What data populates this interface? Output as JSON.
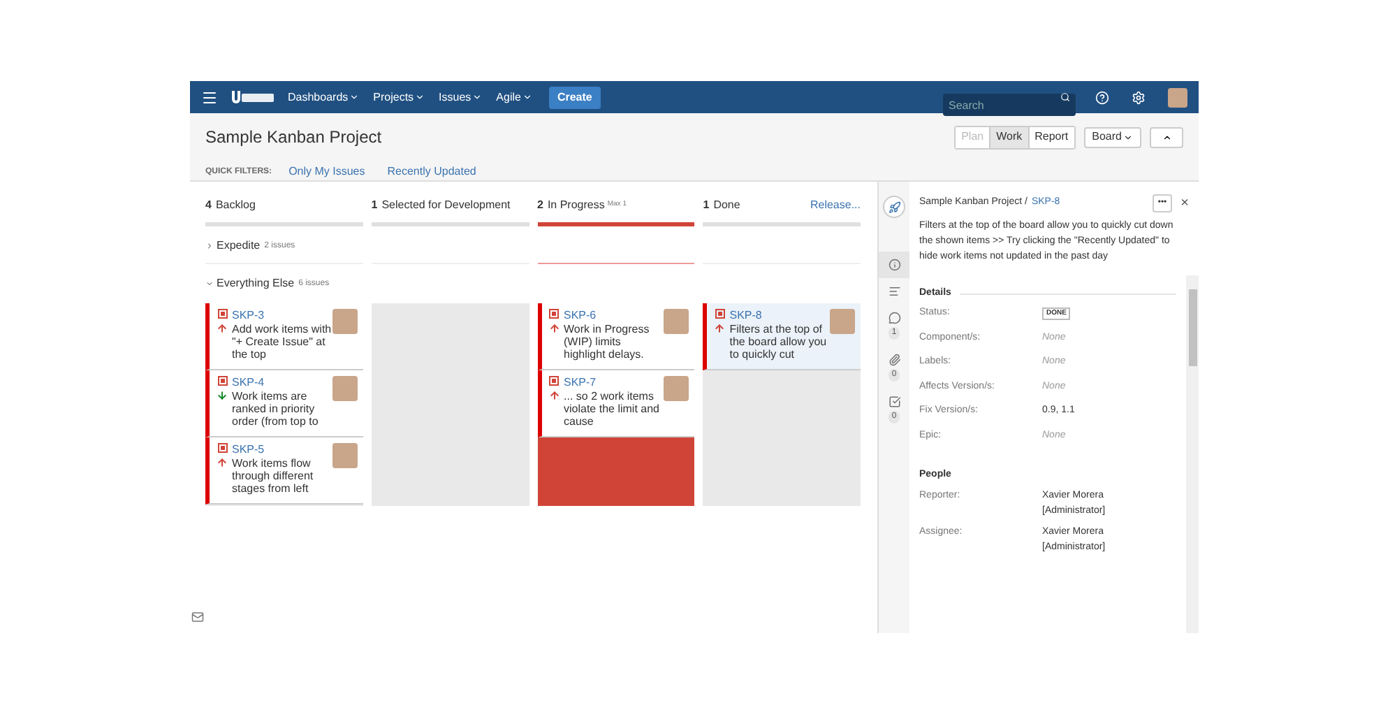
{
  "nav": {
    "menus": [
      "Dashboards",
      "Projects",
      "Issues",
      "Agile"
    ],
    "create": "Create",
    "search_placeholder": "Search"
  },
  "header": {
    "title": "Sample Kanban Project",
    "views": [
      {
        "label": "Plan",
        "selected": false,
        "disabled": true
      },
      {
        "label": "Work",
        "selected": true,
        "disabled": false
      },
      {
        "label": "Report",
        "selected": false,
        "disabled": false
      }
    ],
    "board_button": "Board"
  },
  "quick_filters": {
    "label": "QUICK FILTERS:",
    "items": [
      "Only My Issues",
      "Recently Updated"
    ]
  },
  "columns": [
    {
      "count": "4",
      "name": "Backlog",
      "over_limit": false
    },
    {
      "count": "1",
      "name": "Selected for Development",
      "over_limit": false
    },
    {
      "count": "2",
      "name": "In Progress",
      "limit": "Max 1",
      "over_limit": true
    },
    {
      "count": "1",
      "name": "Done",
      "action": "Release...",
      "over_limit": false
    }
  ],
  "swimlanes": [
    {
      "name": "Expedite",
      "count": "2 issues",
      "expanded": false
    },
    {
      "name": "Everything Else",
      "count": "6 issues",
      "expanded": true,
      "cells": [
        [
          {
            "key": "SKP-3",
            "summary": "Add work items with \"+ Create Issue\" at the top",
            "kind": "up",
            "selected": false
          },
          {
            "key": "SKP-4",
            "summary": "Work items are ranked in priority order (from top to",
            "kind": "down",
            "selected": false
          },
          {
            "key": "SKP-5",
            "summary": "Work items flow through different stages from left",
            "kind": "up",
            "selected": false
          }
        ],
        [],
        [
          {
            "key": "SKP-6",
            "summary": "Work in Progress (WIP) limits highlight delays.",
            "kind": "up",
            "selected": false
          },
          {
            "key": "SKP-7",
            "summary": "... so 2 work items violate the limit and cause",
            "kind": "up",
            "selected": false
          }
        ],
        [
          {
            "key": "SKP-8",
            "summary": "Filters at the top of the board allow you to quickly cut",
            "kind": "up",
            "selected": true
          }
        ]
      ]
    }
  ],
  "detail": {
    "project": "Sample Kanban Project /",
    "key": "SKP-8",
    "more": "•••",
    "close": "×",
    "description": "Filters at the top of the board allow you to quickly cut down the shown items >> Try clicking the \"Recently Updated\" to hide work items not updated in the past day",
    "tabs": [
      {
        "kind": "info",
        "selected": true
      },
      {
        "kind": "description",
        "selected": false
      },
      {
        "kind": "comments",
        "count": "1",
        "selected": false
      },
      {
        "kind": "attachments",
        "count": "0",
        "selected": false
      },
      {
        "kind": "subtasks",
        "count": "0",
        "selected": false
      }
    ],
    "details_heading": "Details",
    "fields": [
      {
        "label": "Status:",
        "value": "DONE",
        "kind": "badge"
      },
      {
        "label": "Component/s:",
        "value": "None",
        "kind": "none"
      },
      {
        "label": "Labels:",
        "value": "None",
        "kind": "none"
      },
      {
        "label": "Affects Version/s:",
        "value": "None",
        "kind": "none"
      },
      {
        "label": "Fix Version/s:",
        "value": "0.9, 1.1",
        "kind": "text"
      },
      {
        "label": "Epic:",
        "value": "None",
        "kind": "none"
      }
    ],
    "people_heading": "People",
    "people": [
      {
        "label": "Reporter:",
        "value": "Xavier Morera [Administrator]"
      },
      {
        "label": "Assignee:",
        "value": "Xavier Morera [Administrator]"
      }
    ]
  }
}
